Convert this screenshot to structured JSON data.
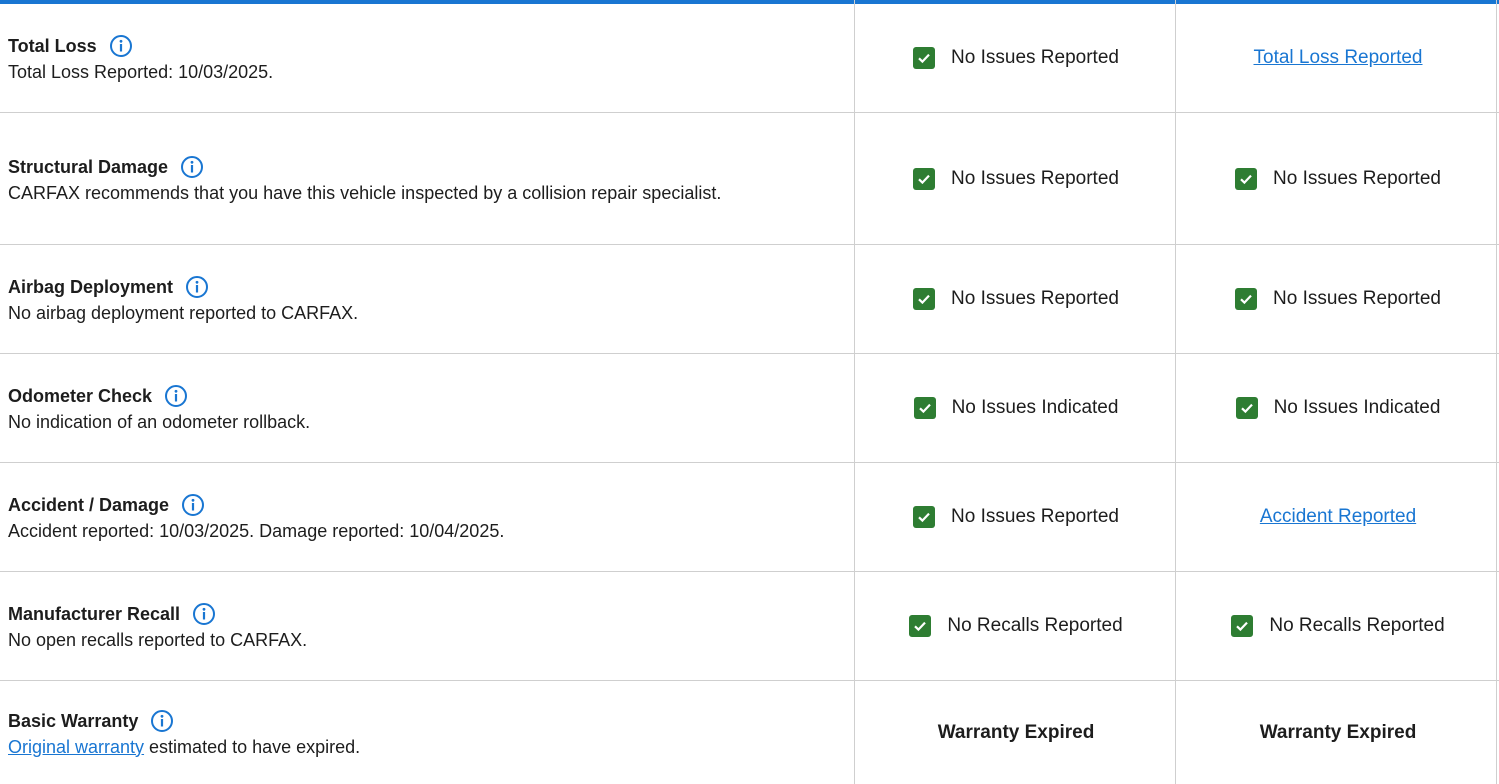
{
  "accent_color": "#1976d2",
  "check_color": "#2e7d32",
  "rows": [
    {
      "title": "Total Loss",
      "desc": "Total Loss Reported: 10/03/2025.",
      "col1": {
        "type": "check",
        "text": "No Issues Reported"
      },
      "col2": {
        "type": "link",
        "text": "Total Loss Reported"
      }
    },
    {
      "title": "Structural Damage",
      "desc": "CARFAX recommends that you have this vehicle inspected by a collision repair specialist.",
      "col1": {
        "type": "check",
        "text": "No Issues Reported"
      },
      "col2": {
        "type": "check",
        "text": "No Issues Reported"
      }
    },
    {
      "title": "Airbag Deployment",
      "desc": "No airbag deployment reported to CARFAX.",
      "col1": {
        "type": "check",
        "text": "No Issues Reported"
      },
      "col2": {
        "type": "check",
        "text": "No Issues Reported"
      }
    },
    {
      "title": "Odometer Check",
      "desc": "No indication of an odometer rollback.",
      "col1": {
        "type": "check",
        "text": "No Issues Indicated"
      },
      "col2": {
        "type": "check",
        "text": "No Issues Indicated"
      }
    },
    {
      "title": "Accident / Damage",
      "desc": "Accident reported: 10/03/2025. Damage reported: 10/04/2025.",
      "col1": {
        "type": "check",
        "text": "No Issues Reported"
      },
      "col2": {
        "type": "link",
        "text": "Accident Reported"
      }
    },
    {
      "title": "Manufacturer Recall",
      "desc": "No open recalls reported to CARFAX.",
      "col1": {
        "type": "check",
        "text": "No Recalls Reported"
      },
      "col2": {
        "type": "check",
        "text": "No Recalls Reported"
      }
    },
    {
      "title": "Basic Warranty",
      "desc_link": "Original warranty",
      "desc_rest": " estimated to have expired.",
      "col1": {
        "type": "bold",
        "text": "Warranty Expired"
      },
      "col2": {
        "type": "bold",
        "text": "Warranty Expired"
      }
    }
  ]
}
